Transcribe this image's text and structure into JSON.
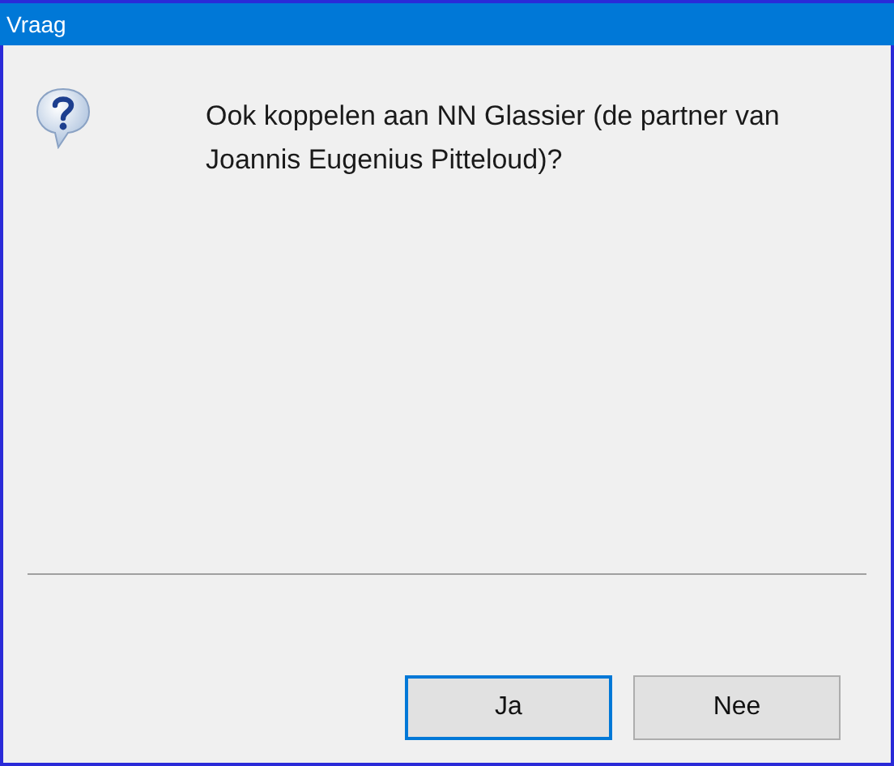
{
  "window": {
    "title": "Vraag"
  },
  "message": "Ook koppelen aan NN Glassier (de partner van Joannis Eugenius Pitteloud)?",
  "buttons": [
    {
      "label": "Ja",
      "default": true
    },
    {
      "label": "Nee",
      "default": false
    }
  ]
}
